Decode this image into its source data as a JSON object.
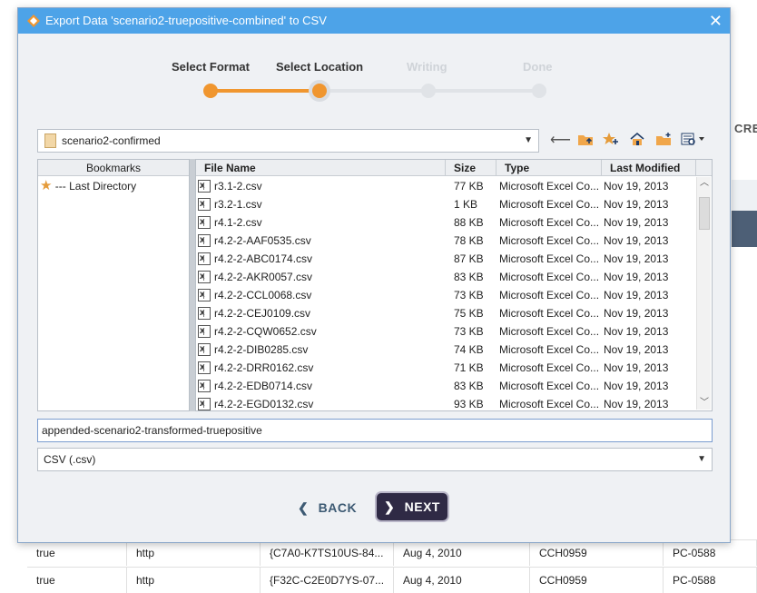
{
  "background": {
    "right_label": "CRE",
    "rows": [
      [
        "true",
        "http",
        "{C7A0-K7TS10US-84...",
        "Aug 4, 2010",
        "CCH0959",
        "PC-0588"
      ],
      [
        "true",
        "http",
        "{F32C-C2E0D7YS-07...",
        "Aug 4, 2010",
        "CCH0959",
        "PC-0588"
      ]
    ]
  },
  "dialog": {
    "title": "Export Data 'scenario2-truepositive-combined' to CSV",
    "close_label": "✕",
    "steps": [
      {
        "label": "Select Format",
        "state": "done"
      },
      {
        "label": "Select Location",
        "state": "current"
      },
      {
        "label": "Writing",
        "state": "pending"
      },
      {
        "label": "Done",
        "state": "pending"
      }
    ],
    "location": "scenario2-confirmed",
    "toolbar_icons": [
      "back-arrow-icon",
      "up-folder-icon",
      "add-bookmark-icon",
      "home-icon",
      "new-folder-icon",
      "view-menu-icon"
    ],
    "bookmarks": {
      "header": "Bookmarks",
      "items": [
        "--- Last Directory"
      ]
    },
    "file_table": {
      "columns": [
        "File Name",
        "Size",
        "Type",
        "Last Modified"
      ],
      "rows": [
        [
          "r3.1-2.csv",
          "77 KB",
          "Microsoft Excel Co...",
          "Nov 19, 2013"
        ],
        [
          "r3.2-1.csv",
          "1 KB",
          "Microsoft Excel Co...",
          "Nov 19, 2013"
        ],
        [
          "r4.1-2.csv",
          "88 KB",
          "Microsoft Excel Co...",
          "Nov 19, 2013"
        ],
        [
          "r4.2-2-AAF0535.csv",
          "78 KB",
          "Microsoft Excel Co...",
          "Nov 19, 2013"
        ],
        [
          "r4.2-2-ABC0174.csv",
          "87 KB",
          "Microsoft Excel Co...",
          "Nov 19, 2013"
        ],
        [
          "r4.2-2-AKR0057.csv",
          "83 KB",
          "Microsoft Excel Co...",
          "Nov 19, 2013"
        ],
        [
          "r4.2-2-CCL0068.csv",
          "73 KB",
          "Microsoft Excel Co...",
          "Nov 19, 2013"
        ],
        [
          "r4.2-2-CEJ0109.csv",
          "75 KB",
          "Microsoft Excel Co...",
          "Nov 19, 2013"
        ],
        [
          "r4.2-2-CQW0652.csv",
          "73 KB",
          "Microsoft Excel Co...",
          "Nov 19, 2013"
        ],
        [
          "r4.2-2-DIB0285.csv",
          "74 KB",
          "Microsoft Excel Co...",
          "Nov 19, 2013"
        ],
        [
          "r4.2-2-DRR0162.csv",
          "71 KB",
          "Microsoft Excel Co...",
          "Nov 19, 2013"
        ],
        [
          "r4.2-2-EDB0714.csv",
          "83 KB",
          "Microsoft Excel Co...",
          "Nov 19, 2013"
        ],
        [
          "r4.2-2-EGD0132.csv",
          "93 KB",
          "Microsoft Excel Co...",
          "Nov 19, 2013"
        ]
      ]
    },
    "filename": "appended-scenario2-transformed-truepositive",
    "file_type": "CSV (.csv)",
    "back_label": "BACK",
    "next_label": "NEXT",
    "colors": {
      "accent": "#f0962f",
      "title_bar": "#4da3e8",
      "next_bg": "#2f2a45"
    }
  }
}
